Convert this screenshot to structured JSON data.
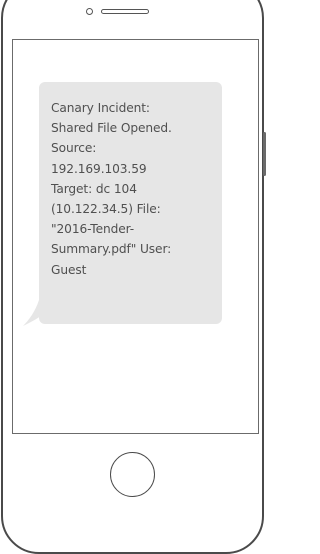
{
  "message": {
    "text": "Canary Incident:\nShared File Opened.\nSource:\n192.169.103.59\nTarget: dc 104\n(10.122.34.5) File:\n\"2016-Tender-\nSummary.pdf\" User:\nGuest"
  },
  "colors": {
    "bubble": "#e6e6e6",
    "text": "#505050",
    "outline": "#4a4a4a"
  }
}
